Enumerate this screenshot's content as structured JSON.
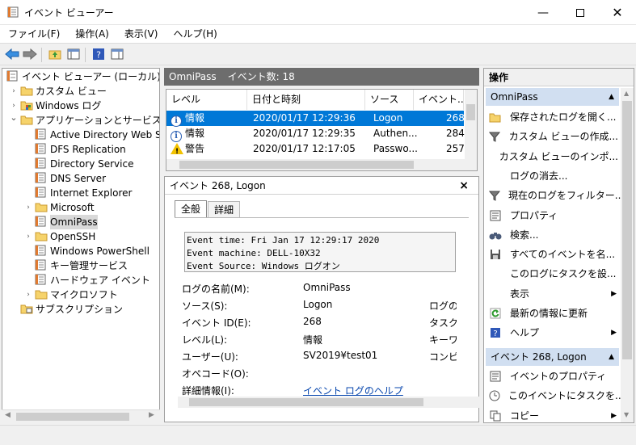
{
  "window": {
    "title": "イベント ビューアー"
  },
  "menu": [
    "ファイル(F)",
    "操作(A)",
    "表示(V)",
    "ヘルプ(H)"
  ],
  "tree": {
    "root": "イベント ビューアー (ローカル)",
    "items": [
      {
        "label": "カスタム ビュー",
        "expander": "›",
        "icon": "folder-icon"
      },
      {
        "label": "Windows ログ",
        "expander": "›",
        "icon": "windows-log-icon"
      },
      {
        "label": "アプリケーションとサービス ログ",
        "expander": "⌄",
        "icon": "folder-icon"
      },
      {
        "label": "Active Directory Web Ser",
        "icon": "log-icon"
      },
      {
        "label": "DFS Replication",
        "icon": "log-icon"
      },
      {
        "label": "Directory Service",
        "icon": "log-icon"
      },
      {
        "label": "DNS Server",
        "icon": "log-icon"
      },
      {
        "label": "Internet Explorer",
        "icon": "log-icon"
      },
      {
        "label": "Microsoft",
        "expander": "›",
        "icon": "folder-icon"
      },
      {
        "label": "OmniPass",
        "icon": "log-icon",
        "selected": true
      },
      {
        "label": "OpenSSH",
        "expander": "›",
        "icon": "folder-icon"
      },
      {
        "label": "Windows PowerShell",
        "icon": "log-icon"
      },
      {
        "label": "キー管理サービス",
        "icon": "log-icon"
      },
      {
        "label": "ハードウェア イベント",
        "icon": "log-icon"
      },
      {
        "label": "マイクロソフト",
        "expander": "›",
        "icon": "folder-icon"
      },
      {
        "label": "サブスクリプション",
        "icon": "subscription-icon"
      }
    ]
  },
  "middle": {
    "header_name": "OmniPass",
    "header_count": "イベント数: 18",
    "columns": [
      "レベル",
      "日付と時刻",
      "ソース",
      "イベント..."
    ],
    "rows": [
      {
        "level": "情報",
        "datetime": "2020/01/17 12:29:36",
        "source": "Logon",
        "id": "268",
        "icon": "info"
      },
      {
        "level": "情報",
        "datetime": "2020/01/17 12:29:35",
        "source": "Authen...",
        "id": "284",
        "icon": "info"
      },
      {
        "level": "警告",
        "datetime": "2020/01/17 12:17:05",
        "source": "Passwo...",
        "id": "257",
        "icon": "warning"
      }
    ]
  },
  "detail": {
    "title": "イベント 268, Logon",
    "close": "×",
    "tabs": [
      "全般",
      "詳細"
    ],
    "description": [
      "Event time: Fri Jan 17 12:29:17 2020",
      "Event machine: DELL-10X32",
      "Event Source: Windows ログオン"
    ],
    "fields": [
      {
        "label": "ログの名前(M):",
        "value": "OmniPass"
      },
      {
        "label": "ソース(S):",
        "value": "Logon",
        "right": "ログの日"
      },
      {
        "label": "イベント ID(E):",
        "value": "268",
        "right": "タスクの"
      },
      {
        "label": "レベル(L):",
        "value": "情報",
        "right": "キーワー"
      },
      {
        "label": "ユーザー(U):",
        "value": "SV2019¥test01",
        "right": "コンピュ"
      },
      {
        "label": "オペコード(O):",
        "value": ""
      },
      {
        "label": "詳細情報(I):",
        "value": "イベント ログのヘルプ"
      }
    ]
  },
  "actions": {
    "title": "操作",
    "section1": "OmniPass",
    "items1": [
      {
        "label": "保存されたログを開く...",
        "icon": "open-log-icon"
      },
      {
        "label": "カスタム ビューの作成...",
        "icon": "filter-icon"
      },
      {
        "label": "カスタム ビューのインポ...",
        "icon": ""
      },
      {
        "label": "ログの消去...",
        "icon": ""
      },
      {
        "label": "現在のログをフィルター...",
        "icon": "filter-icon"
      },
      {
        "label": "プロパティ",
        "icon": "properties-icon"
      },
      {
        "label": "検索...",
        "icon": "binoculars-icon"
      },
      {
        "label": "すべてのイベントを名...",
        "icon": "save-icon"
      },
      {
        "label": "このログにタスクを設...",
        "icon": ""
      },
      {
        "label": "表示",
        "icon": "",
        "arrow": "▶"
      },
      {
        "label": "最新の情報に更新",
        "icon": "refresh-icon"
      },
      {
        "label": "ヘルプ",
        "icon": "help-icon",
        "arrow": "▶"
      }
    ],
    "section2": "イベント 268, Logon",
    "items2": [
      {
        "label": "イベントのプロパティ",
        "icon": "properties-icon"
      },
      {
        "label": "このイベントにタスクを...",
        "icon": "task-icon"
      },
      {
        "label": "コピー",
        "icon": "copy-icon",
        "arrow": "▶"
      }
    ]
  },
  "colors": {
    "selection": "#0078d7",
    "section": "#d1dff1",
    "header": "#6d6d6d"
  }
}
